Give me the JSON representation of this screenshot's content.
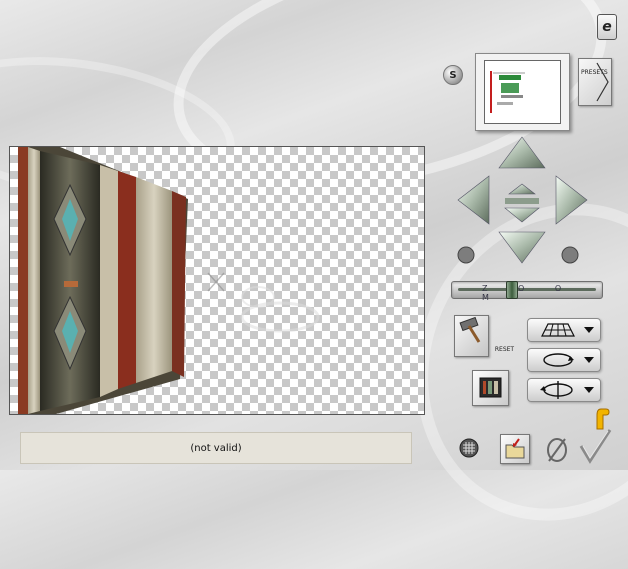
{
  "status": {
    "text": "(not valid)"
  },
  "preview": {
    "s_label": "S",
    "presets_label": "PRESETS"
  },
  "toolbar": {
    "reset_label": "RESET",
    "zoom_label": "Z O O M"
  },
  "zoom": {
    "level": 0.38
  },
  "colors": {
    "accent_green": "#3c5c3c",
    "help_yellow": "#f2b400"
  },
  "icons": {
    "help": "help-icon",
    "move_up": "arrow-up-icon",
    "move_down": "arrow-down-icon",
    "move_left": "arrow-left-icon",
    "move_right": "arrow-right-icon",
    "rotate_left": "rotate-left-icon",
    "rotate_right": "rotate-right-icon",
    "perspective": "perspective-grid-icon",
    "rotate_h": "rotate-horizontal-icon",
    "rotate_v": "rotate-vertical-icon",
    "grid": "grid-icon",
    "open": "folder-open-icon",
    "cancel": "cancel-icon",
    "ok": "checkmark-icon",
    "hint": "pointing-hand-icon"
  }
}
